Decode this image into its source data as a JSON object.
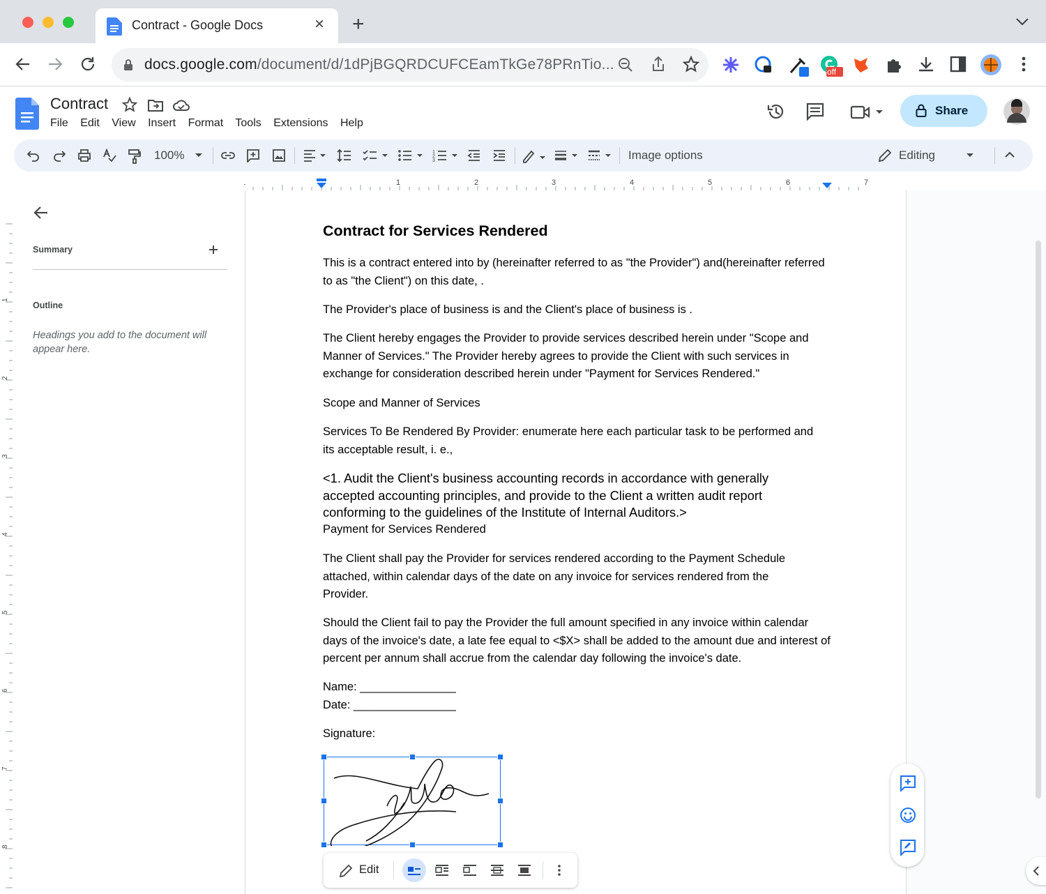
{
  "browser": {
    "tab_title": "Contract - Google Docs",
    "url_host": "docs.google.com",
    "url_path": "/document/d/1dPjBGQRDCUFCEamTkGe78PRnTio...",
    "extension_badge": "off"
  },
  "docs": {
    "title": "Contract",
    "menus": [
      "File",
      "Edit",
      "View",
      "Insert",
      "Format",
      "Tools",
      "Extensions",
      "Help"
    ],
    "share_label": "Share"
  },
  "toolbar": {
    "zoom": "100%",
    "image_options": "Image options",
    "mode": "Editing"
  },
  "ruler": {
    "h_labels": [
      "1",
      "1",
      "2",
      "3",
      "4",
      "5",
      "6",
      "7"
    ],
    "v_labels": [
      "1",
      "2",
      "3",
      "4",
      "5",
      "6",
      "7",
      "8"
    ]
  },
  "sidebar": {
    "summary_label": "Summary",
    "outline_label": "Outline",
    "outline_empty": "Headings you add to the document will appear here."
  },
  "document": {
    "heading": "Contract for Services Rendered",
    "p1": "This is a contract entered into by (hereinafter referred to as \"the Provider\") and(hereinafter referred to as \"the Client\") on this date, .",
    "p2": "The Provider's place of business is and the Client's place of business is .",
    "p3": "The Client hereby engages the Provider to provide services described herein under \"Scope and Manner of Services.\" The Provider hereby agrees to provide the Client with such services in exchange for consideration described herein under \"Payment for Services Rendered.\"",
    "p4": "Scope and Manner of Services",
    "p5": "Services To Be Rendered By Provider: enumerate here each particular task to be performed and its acceptable result, i. e.,",
    "p6": "<1. Audit the Client's business accounting records in accordance with generally accepted accounting principles, and provide to the Client a written audit report conforming to the guidelines of the Institute of Internal Auditors.>",
    "p7": "Payment for Services Rendered",
    "p8": "The Client shall pay the Provider for services rendered according to the Payment Schedule attached, within calendar days of the date on any invoice for services rendered from the Provider.",
    "p9": "Should the Client fail to pay the Provider the full amount specified in any invoice within calendar days of the invoice's date, a late fee equal to <$X> shall be added to the amount due and interest of percent per annum shall accrue from the calendar day following the invoice's date.",
    "name_line": "Name: _______________",
    "date_line": "Date: ________________",
    "signature_label": "Signature:"
  },
  "image_bar": {
    "edit_label": "Edit"
  },
  "icons": {
    "star": "star-icon",
    "move": "folder-move-icon",
    "cloud": "cloud-saved-icon",
    "history": "history-icon",
    "comments": "comment-icon",
    "meet": "video-icon",
    "lock": "lock-icon"
  },
  "colors": {
    "accent": "#1a73e8",
    "share_bg": "#c2e7ff",
    "toolbar_bg": "#edf2fa",
    "tab_strip": "#dee1e6"
  }
}
